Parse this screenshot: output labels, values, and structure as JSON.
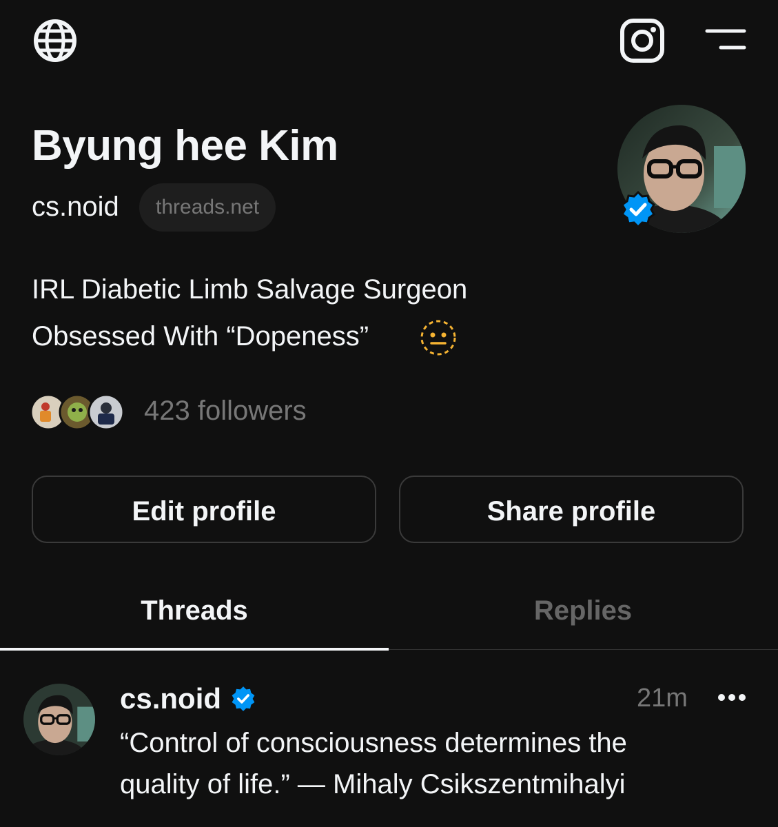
{
  "header": {
    "left_icon": "globe-icon",
    "right_icons": [
      "instagram-icon",
      "menu-icon"
    ]
  },
  "profile": {
    "name": "Byung hee Kim",
    "handle": "cs.noid",
    "domain_badge": "threads.net",
    "verified": true,
    "bio_line_1": "IRL Diabetic Limb Salvage Surgeon",
    "bio_line_2": "Obsessed With “Dopeness”",
    "bio_emoji": "dotted-neutral-face-icon",
    "followers_text": "423 followers"
  },
  "buttons": {
    "edit": "Edit profile",
    "share": "Share profile"
  },
  "tabs": [
    {
      "label": "Threads",
      "active": true
    },
    {
      "label": "Replies",
      "active": false
    }
  ],
  "post": {
    "username": "cs.noid",
    "verified": true,
    "time": "21m",
    "text_line_1": "“Control of consciousness determines the",
    "text_line_2": "quality of life.” — Mihaly Csikszentmihalyi"
  },
  "colors": {
    "background": "#101010",
    "text_primary": "#f3f5f7",
    "text_secondary": "#777777",
    "verified_blue": "#0095f6",
    "border": "#3a3a3a",
    "emoji_yellow": "#f5b332"
  }
}
